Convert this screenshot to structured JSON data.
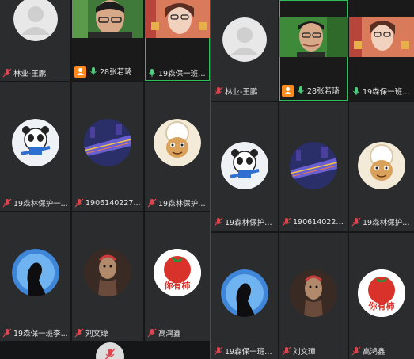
{
  "colors": {
    "mic_red": "#e0444f",
    "mic_green": "#4cd07d",
    "active_border": "#2fbf5a",
    "badge_orange": "#ff8a1f"
  },
  "left": {
    "tiles": [
      {
        "name": "林业-王鹏",
        "avatar": "default-avatar-icon",
        "mic": "muted"
      },
      {
        "name": "28张若琦",
        "avatar": "webcam-video",
        "mic": "on",
        "badge": "orange-user-badge"
      },
      {
        "name": "19森保一班肖...",
        "avatar": "webcam-video",
        "mic": "on",
        "active": true
      },
      {
        "name": "19森林保护一...",
        "avatar": "cartoon-panda-skier-avatar",
        "mic": "muted"
      },
      {
        "name": "1906140227...",
        "avatar": "city-road-night-avatar",
        "mic": "muted"
      },
      {
        "name": "19森林保护一...",
        "avatar": "cartoon-sheep-avatar",
        "mic": "muted"
      },
      {
        "name": "19森保一班李...",
        "avatar": "silhouette-avatar",
        "mic": "muted"
      },
      {
        "name": "刘文璋",
        "avatar": "dark-figure-avatar",
        "mic": "muted"
      },
      {
        "name": "高鸿鑫",
        "avatar": "tomato-avatar",
        "mic": "muted"
      }
    ],
    "tomato_text": "你有柿"
  },
  "right": {
    "tiles": [
      {
        "name": "林业-王鹏",
        "avatar": "default-avatar-icon",
        "mic": "muted"
      },
      {
        "name": "28张若琦",
        "avatar": "webcam-video",
        "mic": "on",
        "badge": "orange-user-badge",
        "active": true
      },
      {
        "name": "19森保一班肖...",
        "avatar": "webcam-video",
        "mic": "on"
      },
      {
        "name": "19森林保护一...",
        "avatar": "cartoon-panda-skier-avatar",
        "mic": "muted"
      },
      {
        "name": "1906140227...",
        "avatar": "city-road-night-avatar",
        "mic": "muted"
      },
      {
        "name": "19森林保护一...",
        "avatar": "cartoon-sheep-avatar",
        "mic": "muted"
      },
      {
        "name": "19森保一班李...",
        "avatar": "silhouette-avatar",
        "mic": "muted"
      },
      {
        "name": "刘文璋",
        "avatar": "dark-figure-avatar",
        "mic": "muted"
      },
      {
        "name": "高鸿鑫",
        "avatar": "tomato-avatar",
        "mic": "muted"
      }
    ],
    "tomato_text": "你有柿"
  },
  "toolbar": {
    "mute_icon": "muted-mic-icon"
  }
}
